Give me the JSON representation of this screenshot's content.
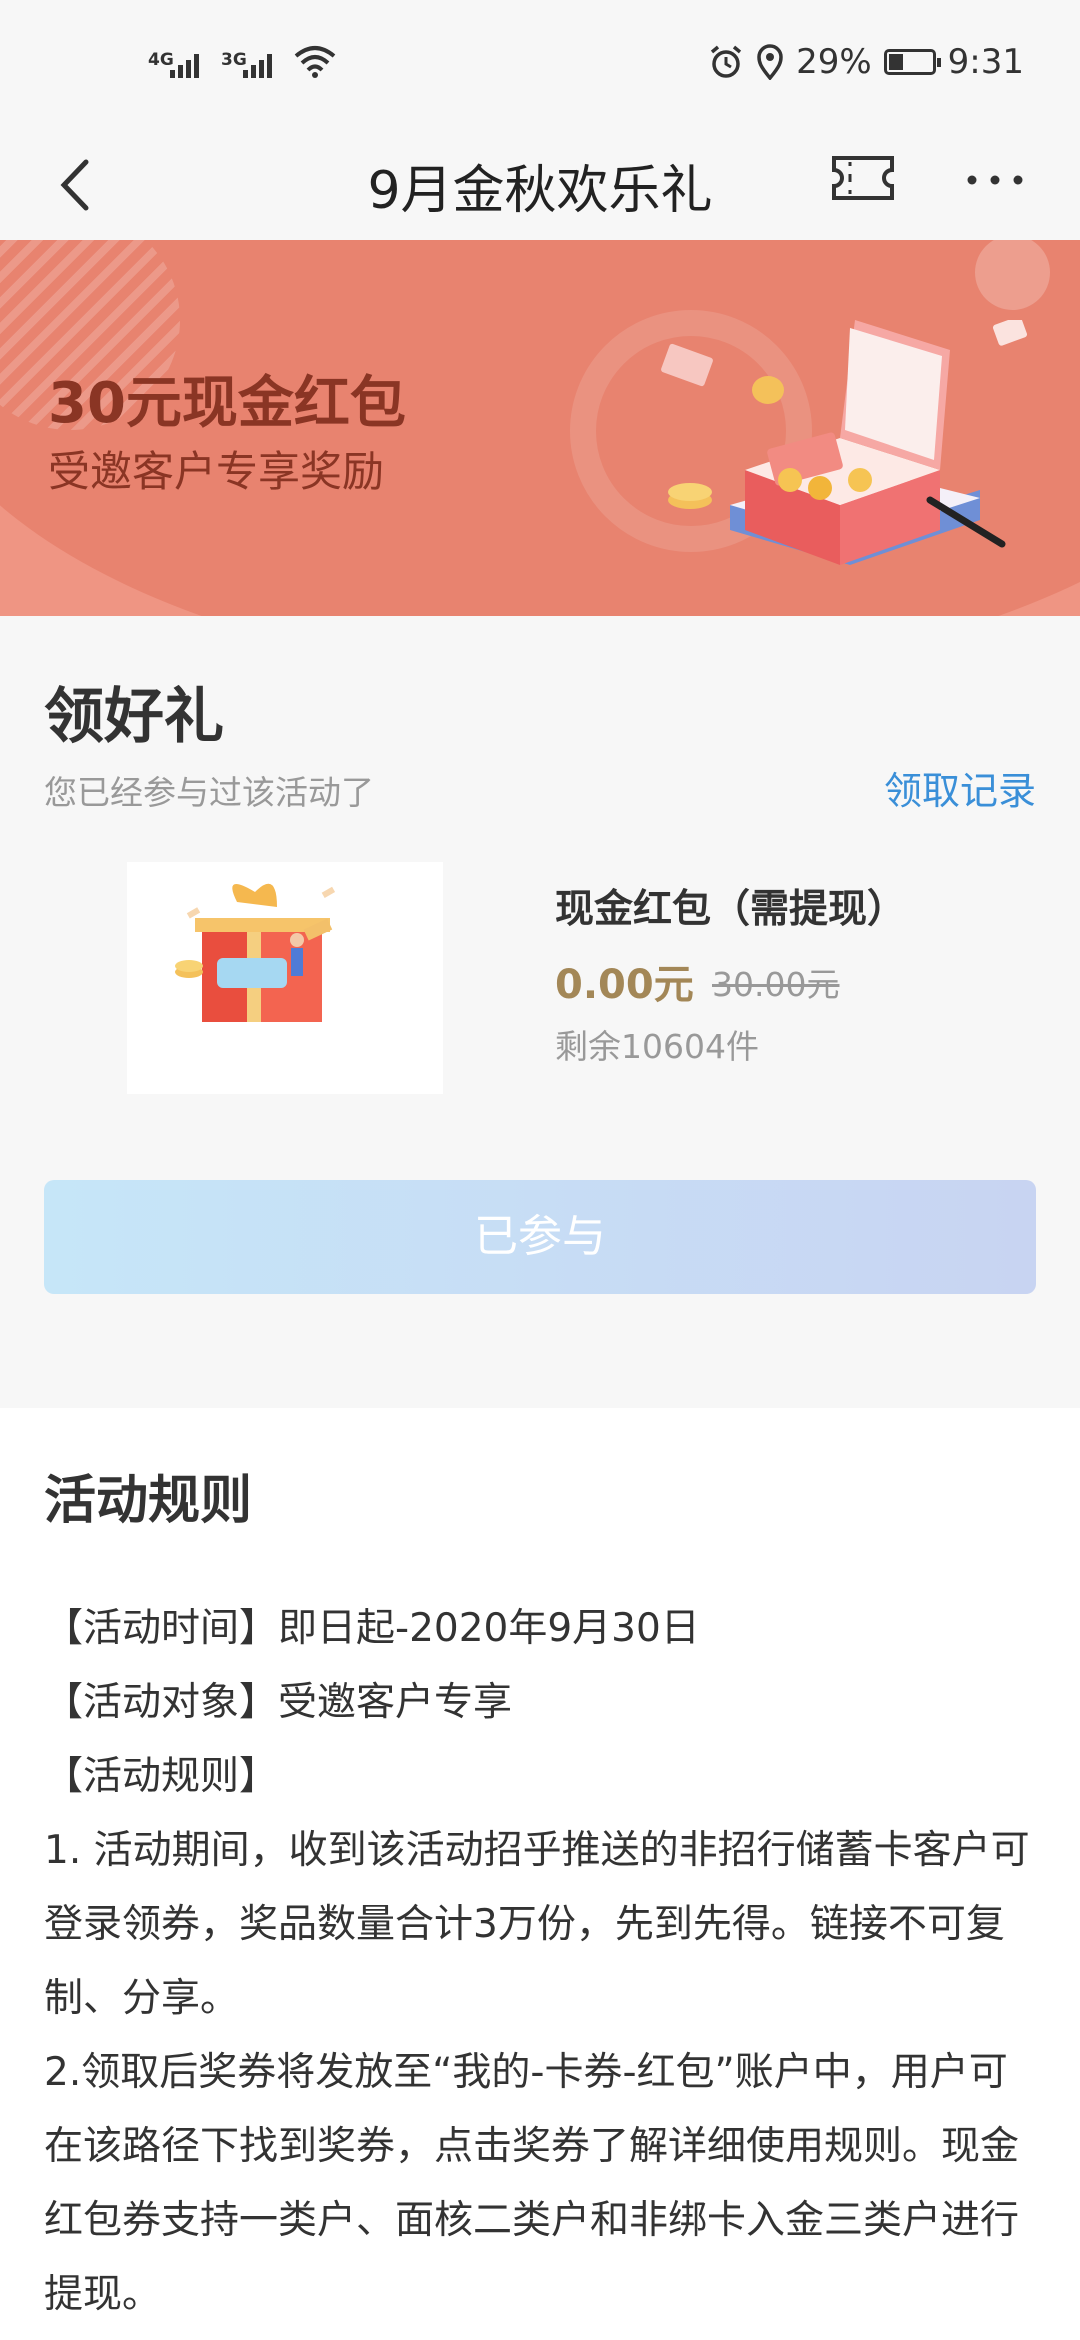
{
  "status_bar": {
    "network1": "4G",
    "network2": "3G",
    "battery": "29%",
    "time": "9:31"
  },
  "nav": {
    "title": "9月金秋欢乐礼"
  },
  "banner": {
    "headline": "30元现金红包",
    "subheadline": "受邀客户专享奖励"
  },
  "gift": {
    "section_title": "领好礼",
    "participation_note": "您已经参与过该活动了",
    "records_link": "领取记录",
    "product_name": "现金红包（需提现）",
    "price": "0.00元",
    "original_price": "30.00元",
    "stock": "剩余10604件",
    "button_label": "已参与"
  },
  "rules": {
    "title": "活动规则",
    "lines": [
      "【活动时间】即日起-2020年9月30日",
      "【活动对象】受邀客户专享",
      "【活动规则】",
      "1. 活动期间，收到该活动招乎推送的非招行储蓄卡客户可登录领券，奖品数量合计3万份，先到先得。链接不可复制、分享。",
      "2.领取后奖券将发放至“我的-卡券-红包”账户中，用户可在该路径下找到奖券，点击奖券了解详细使用规则。现金红包券支持一类户、面核二类户和非绑卡入金三类户进行提现。"
    ]
  },
  "colors": {
    "banner_bg": "#ef9583",
    "banner_text": "#8a3524",
    "link": "#3a8fd8",
    "price": "#a38757"
  },
  "icons": [
    "signal-icon",
    "wifi-icon",
    "alarm-icon",
    "location-icon",
    "battery-icon",
    "back-arrow-icon",
    "ticket-icon",
    "more-icon"
  ]
}
